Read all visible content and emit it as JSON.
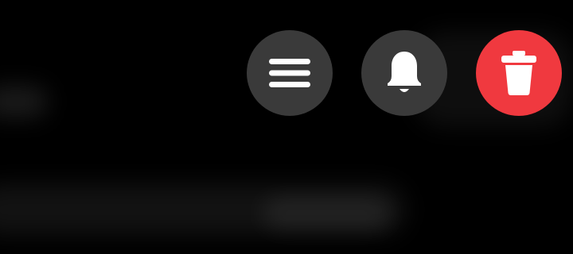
{
  "actions": {
    "menu": {
      "icon": "menu-icon",
      "color": "#3a3a3a"
    },
    "notify": {
      "icon": "bell-icon",
      "color": "#3a3a3a"
    },
    "delete": {
      "icon": "trash-icon",
      "color": "#f0393f"
    }
  },
  "icon_color": "#ffffff",
  "background_color": "#000000"
}
